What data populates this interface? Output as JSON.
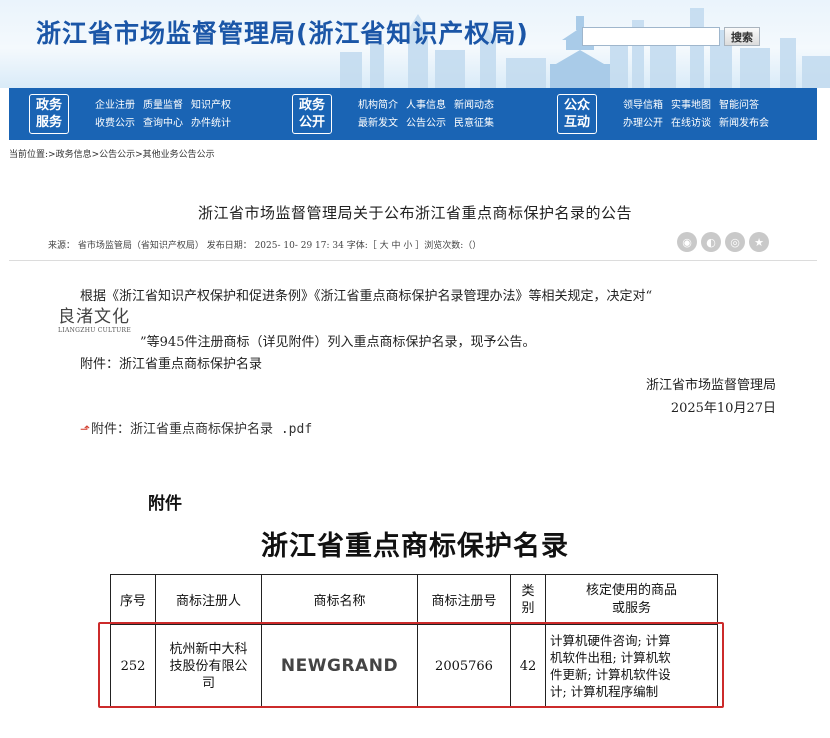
{
  "header": {
    "site_title": "浙江省市场监督管理局(浙江省知识产权局)",
    "search_placeholder": "",
    "search_button": "搜索"
  },
  "nav": [
    {
      "badge_top": "政务",
      "badge_bottom": "服务",
      "row1": [
        "企业注册",
        "质量监督",
        "知识产权"
      ],
      "row2": [
        "收费公示",
        "查询中心",
        "办件统计"
      ]
    },
    {
      "badge_top": "政务",
      "badge_bottom": "公开",
      "row1": [
        "机构简介",
        "人事信息",
        "新闻动态"
      ],
      "row2": [
        "最新发文",
        "公告公示",
        "民意征集"
      ]
    },
    {
      "badge_top": "公众",
      "badge_bottom": "互动",
      "row1": [
        "领导信箱",
        "实事地图",
        "智能问答"
      ],
      "row2": [
        "办理公开",
        "在线访谈",
        "新闻发布会"
      ]
    }
  ],
  "breadcrumb": "当前位置:>政务信息>公告公示>其他业务公告公示",
  "article": {
    "title": "浙江省市场监督管理局关于公布浙江省重点商标保护名录的公告",
    "meta": "来源： 省市场监管局（省知识产权局） 发布日期： 2025- 10- 29 17: 34 字体:［ 大 中 小 ］浏览次数:（）",
    "para1": "根据《浙江省知识产权保护和促进条例》《浙江省重点商标保护名录管理办法》等相关规定，决定对“",
    "logo_cn": "良渚文化",
    "logo_en": "LIANGZHU CULTURE",
    "para2": "”等945件注册商标（详见附件）列入重点商标保护名录，现予公告。",
    "para3": "附件：浙江省重点商标保护名录",
    "sign_org": "浙江省市场监督管理局",
    "sign_date": "2025年10月27日",
    "attachment_link": "附件：浙江省重点商标保护名录 .pdf"
  },
  "share_icons": [
    "weibo-icon",
    "qq-icon",
    "wechat-icon",
    "qzone-icon"
  ],
  "document": {
    "attach_label": "附件",
    "title": "浙江省重点商标保护名录",
    "headers": [
      "序号",
      "商标注册人",
      "商标名称",
      "商标注册号",
      "类\n别",
      "核定使用的商品\n或服务"
    ],
    "row": {
      "no": "252",
      "registrant": "杭州新中大科\n技股份有限公\n司",
      "mark": "NEWGRAND",
      "reg_no": "2005766",
      "class": "42",
      "goods": "计算机硬件咨询; 计算\n机软件出租; 计算机软\n件更新; 计算机软件设\n计; 计算机程序编制"
    }
  },
  "colors": {
    "brand_blue": "#1a64b4",
    "title_blue": "#1b56a7",
    "highlight_red": "#cc2b2b"
  }
}
